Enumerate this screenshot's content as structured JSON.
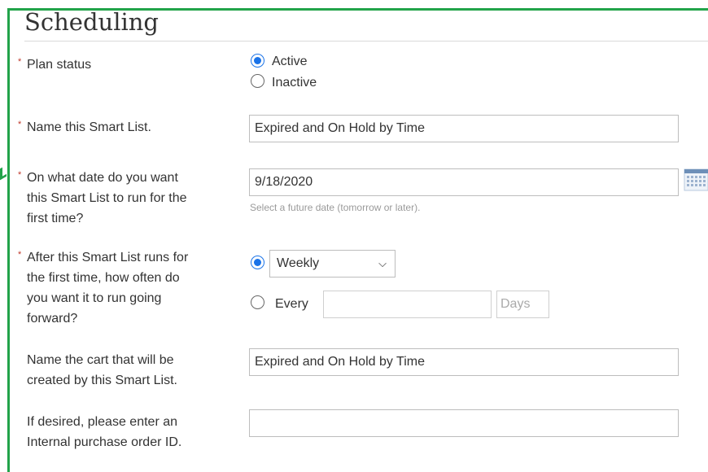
{
  "title": "Scheduling",
  "plan_status": {
    "label": "Plan status",
    "options": [
      "Active",
      "Inactive"
    ],
    "selected": "Active"
  },
  "smart_list_name": {
    "label": "Name this Smart List.",
    "value": "Expired and On Hold by Time"
  },
  "first_run_date": {
    "label_lines": [
      "On what date do you want",
      "this Smart List to run for the",
      "first time?"
    ],
    "value": "9/18/2020",
    "hint": "Select a future date (tomorrow or later)."
  },
  "frequency": {
    "label_lines": [
      "After this Smart List runs for",
      "the first time, how often do",
      "you want it to run going",
      "forward?"
    ],
    "select_value": "Weekly",
    "every_label": "Every",
    "every_value": "",
    "unit": "Days"
  },
  "cart_name": {
    "label_lines": [
      "Name the cart that will be",
      "created by this Smart List."
    ],
    "value": "Expired and On Hold by Time"
  },
  "po_id": {
    "label_lines": [
      "If desired, please enter an",
      "Internal purchase order ID."
    ],
    "value": ""
  },
  "colors": {
    "frame": "#22a34a",
    "radio_selected": "#1a73e8",
    "required": "#c0392b"
  },
  "icons": {
    "date_picker": "calendar-icon",
    "dropdown": "chevron-down-icon"
  }
}
